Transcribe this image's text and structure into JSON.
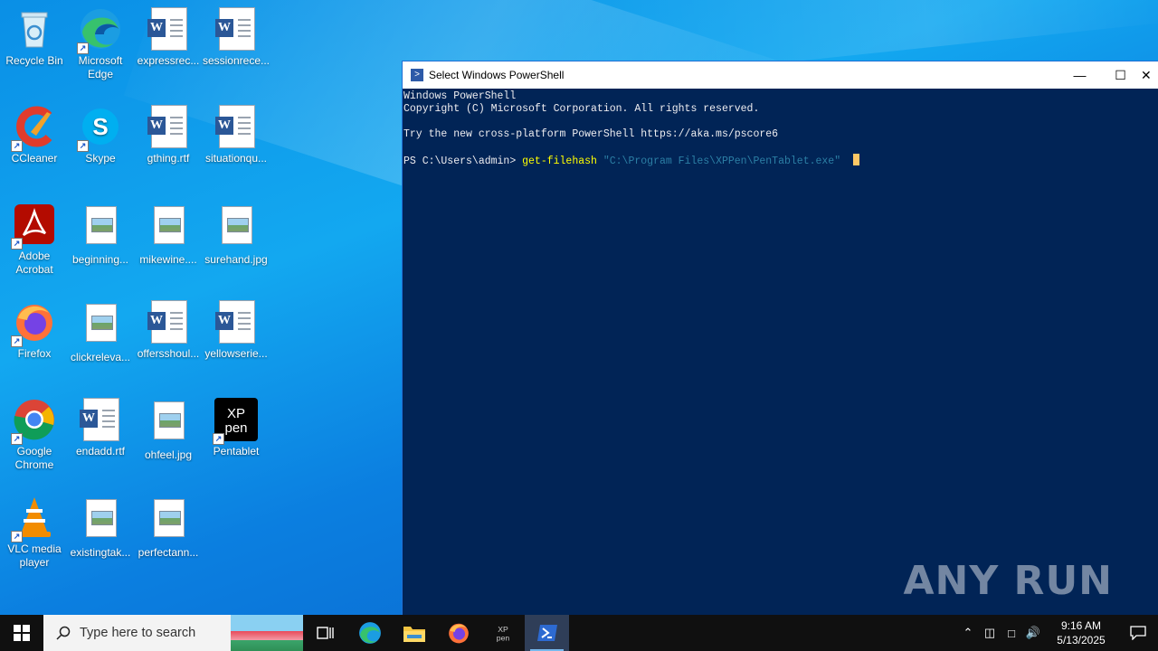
{
  "desktop": {
    "icons": [
      {
        "label": "Recycle Bin",
        "icon": "recycle-bin-icon"
      },
      {
        "label": "Microsoft Edge",
        "icon": "edge-icon"
      },
      {
        "label": "expressrec...",
        "icon": "word-doc-icon"
      },
      {
        "label": "sessionrece...",
        "icon": "word-doc-icon"
      },
      {
        "label": "CCleaner",
        "icon": "ccleaner-icon"
      },
      {
        "label": "Skype",
        "icon": "skype-icon"
      },
      {
        "label": "gthing.rtf",
        "icon": "word-doc-icon"
      },
      {
        "label": "situationqu...",
        "icon": "word-doc-icon"
      },
      {
        "label": "Adobe Acrobat",
        "icon": "acrobat-icon"
      },
      {
        "label": "beginning...",
        "icon": "image-file-icon"
      },
      {
        "label": "mikewine....",
        "icon": "image-file-icon"
      },
      {
        "label": "surehand.jpg",
        "icon": "image-file-icon"
      },
      {
        "label": "Firefox",
        "icon": "firefox-icon"
      },
      {
        "label": "clickreleva...",
        "icon": "image-file-icon"
      },
      {
        "label": "offersshoul...",
        "icon": "word-doc-icon"
      },
      {
        "label": "yellowserie...",
        "icon": "word-doc-icon"
      },
      {
        "label": "Google Chrome",
        "icon": "chrome-icon"
      },
      {
        "label": "endadd.rtf",
        "icon": "word-doc-icon"
      },
      {
        "label": "ohfeel.jpg",
        "icon": "image-file-icon"
      },
      {
        "label": "Pentablet",
        "icon": "xppen-icon"
      },
      {
        "label": "VLC media player",
        "icon": "vlc-icon"
      },
      {
        "label": "existingtak...",
        "icon": "image-file-icon"
      },
      {
        "label": "perfectann...",
        "icon": "image-file-icon"
      }
    ]
  },
  "window": {
    "title": "Select Windows PowerShell",
    "console": {
      "line1": "Windows PowerShell",
      "line2": "Copyright (C) Microsoft Corporation. All rights reserved.",
      "line3": "Try the new cross-platform PowerShell https://aka.ms/pscore6",
      "prompt": "PS C:\\Users\\admin> ",
      "command": "get-filehash",
      "argument": " \"C:\\Program Files\\XPPen\\PenTablet.exe\" "
    }
  },
  "watermark": "ANY RUN",
  "taskbar": {
    "search_placeholder": "Type here to search",
    "time": "9:16 AM",
    "date": "5/13/2025"
  },
  "colors": {
    "console_bg": "#012456",
    "command_yellow": "#ffff00",
    "taskbar_bg": "#101010"
  }
}
